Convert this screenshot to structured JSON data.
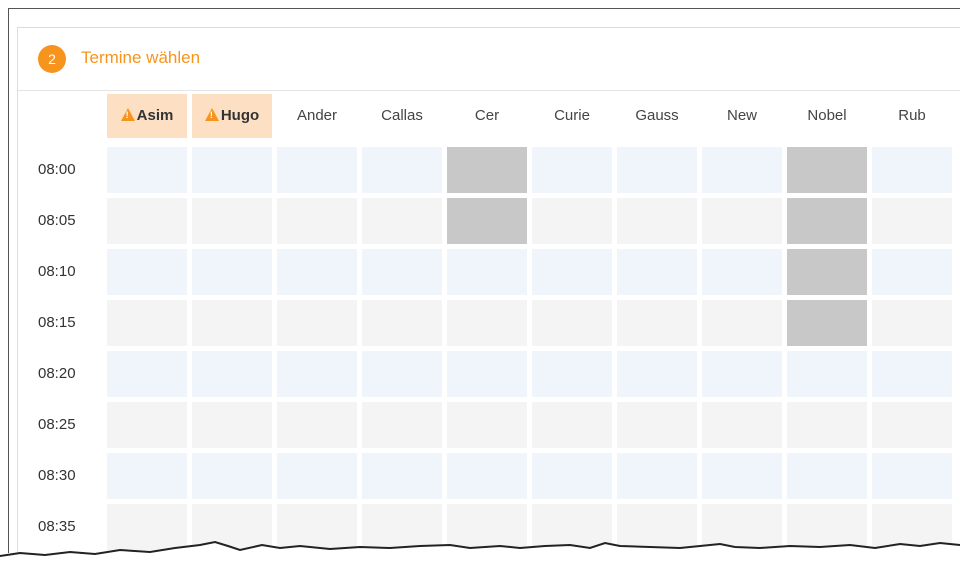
{
  "panel": {
    "step_number": "2",
    "title": "Termine wählen"
  },
  "columns": [
    {
      "label": "Asim",
      "warning": true
    },
    {
      "label": "Hugo",
      "warning": true
    },
    {
      "label": "Ander",
      "warning": false
    },
    {
      "label": "Callas",
      "warning": false
    },
    {
      "label": "Cer",
      "warning": false
    },
    {
      "label": "Curie",
      "warning": false
    },
    {
      "label": "Gauss",
      "warning": false
    },
    {
      "label": "New",
      "warning": false
    },
    {
      "label": "Nobel",
      "warning": false
    },
    {
      "label": "Rub",
      "warning": false
    }
  ],
  "times": [
    "08:00",
    "08:05",
    "08:10",
    "08:15",
    "08:20",
    "08:25",
    "08:30",
    "08:35"
  ],
  "blocked_slots": [
    {
      "column": "Cer",
      "time": "08:00"
    },
    {
      "column": "Cer",
      "time": "08:05"
    },
    {
      "column": "Nobel",
      "time": "08:00"
    },
    {
      "column": "Nobel",
      "time": "08:05"
    },
    {
      "column": "Nobel",
      "time": "08:10"
    },
    {
      "column": "Nobel",
      "time": "08:15"
    }
  ],
  "colors": {
    "accent": "#f7941d",
    "warning_header_bg": "#fde0c4",
    "slot_row_a": "#eff5fb",
    "slot_row_b": "#f4f4f4",
    "slot_blocked": "#c8c8c8"
  }
}
